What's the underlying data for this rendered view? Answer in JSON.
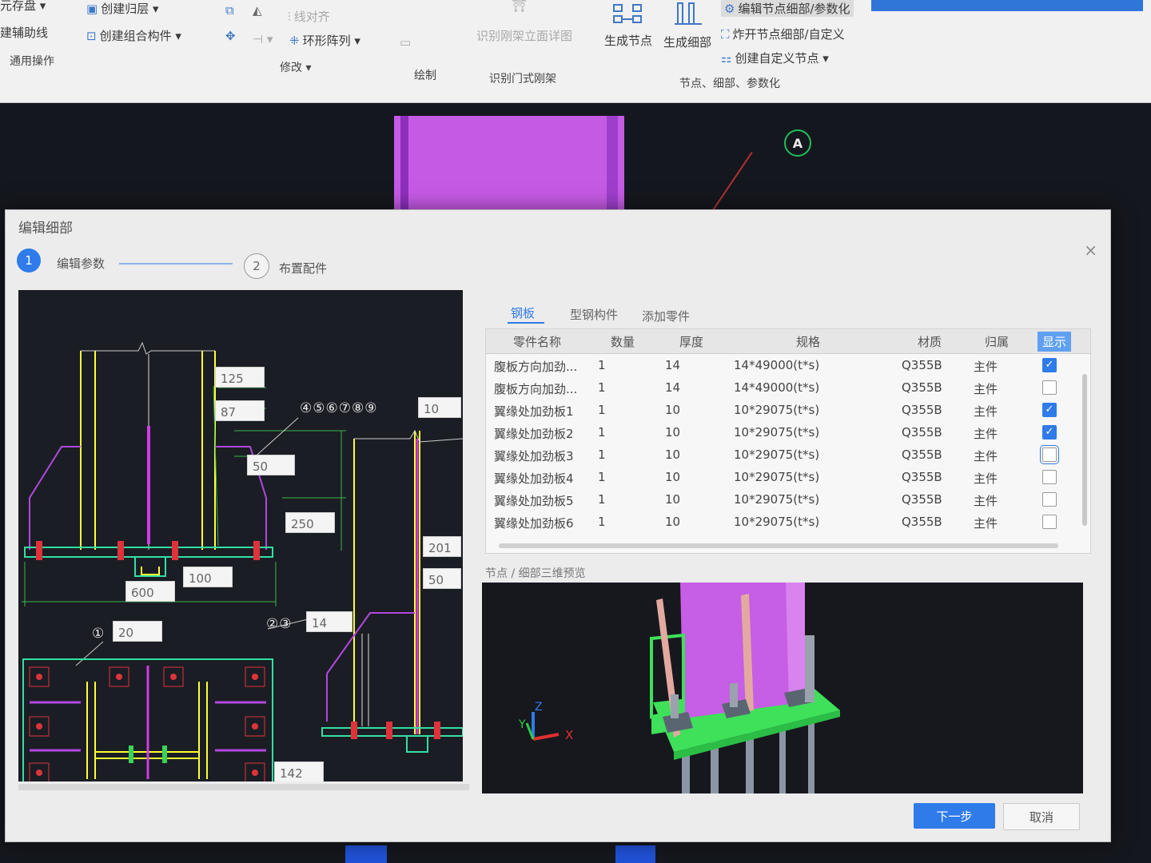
{
  "ribbon": {
    "row1": {
      "save_disk": "元存盘",
      "create_return": "创建归层",
      "align": "线对齐"
    },
    "row2": {
      "build_aux": "建辅助线",
      "create_combo": "创建组合构件",
      "ring_array": "环形阵列",
      "recognize_frame_dim": "识别刚架立面详图"
    },
    "groups": {
      "general": "通用操作",
      "modify": "修改",
      "draw": "绘制",
      "recognize_portal": "识别门式刚架",
      "node_detail_param": "节点、细部、参数化"
    },
    "generate_node": "生成节点",
    "generate_detail": "生成细部",
    "edit_node_param": "编辑节点细部/参数化",
    "explode_node": "炸开节点细部/自定义",
    "create_custom_node": "创建自定义节点"
  },
  "canvas": {
    "axis_label": "A"
  },
  "dialog": {
    "title": "编辑细部",
    "close": "×",
    "steps": [
      {
        "num": "1",
        "label": "编辑参数"
      },
      {
        "num": "2",
        "label": "布置配件"
      }
    ],
    "drawing": {
      "dims": [
        "125",
        "87",
        "50",
        "250",
        "600",
        "100",
        "20",
        "10",
        "201",
        "50",
        "14",
        "142"
      ],
      "markers": {
        "top": "④⑤⑥⑦⑧⑨",
        "one": "①",
        "two_three": "②③"
      }
    },
    "tabs": [
      "钢板",
      "型钢构件",
      "添加零件"
    ],
    "table": {
      "headers": [
        "零件名称",
        "数量",
        "厚度",
        "规格",
        "材质",
        "归属",
        "显示"
      ],
      "rows": [
        {
          "name": "腹板方向加劲...",
          "qty": "1",
          "thk": "14",
          "spec": "14*49000(t*s)",
          "mat": "Q355B",
          "owner": "主件",
          "show": true
        },
        {
          "name": "腹板方向加劲...",
          "qty": "1",
          "thk": "14",
          "spec": "14*49000(t*s)",
          "mat": "Q355B",
          "owner": "主件",
          "show": false
        },
        {
          "name": "翼缘处加劲板1",
          "qty": "1",
          "thk": "10",
          "spec": "10*29075(t*s)",
          "mat": "Q355B",
          "owner": "主件",
          "show": true
        },
        {
          "name": "翼缘处加劲板2",
          "qty": "1",
          "thk": "10",
          "spec": "10*29075(t*s)",
          "mat": "Q355B",
          "owner": "主件",
          "show": true
        },
        {
          "name": "翼缘处加劲板3",
          "qty": "1",
          "thk": "10",
          "spec": "10*29075(t*s)",
          "mat": "Q355B",
          "owner": "主件",
          "show": false
        },
        {
          "name": "翼缘处加劲板4",
          "qty": "1",
          "thk": "10",
          "spec": "10*29075(t*s)",
          "mat": "Q355B",
          "owner": "主件",
          "show": false
        },
        {
          "name": "翼缘处加劲板5",
          "qty": "1",
          "thk": "10",
          "spec": "10*29075(t*s)",
          "mat": "Q355B",
          "owner": "主件",
          "show": false
        },
        {
          "name": "翼缘处加劲板6",
          "qty": "1",
          "thk": "10",
          "spec": "10*29075(t*s)",
          "mat": "Q355B",
          "owner": "主件",
          "show": false
        }
      ]
    },
    "preview_label": "节点 / 细部三维预览",
    "preview_axes": {
      "x": "X",
      "y": "Y",
      "z": "Z"
    },
    "buttons": {
      "next": "下一步",
      "cancel": "取消"
    }
  },
  "colors": {
    "accent": "#2f7bea",
    "beam": "#c55ae5",
    "plate": "#2ecc52"
  }
}
